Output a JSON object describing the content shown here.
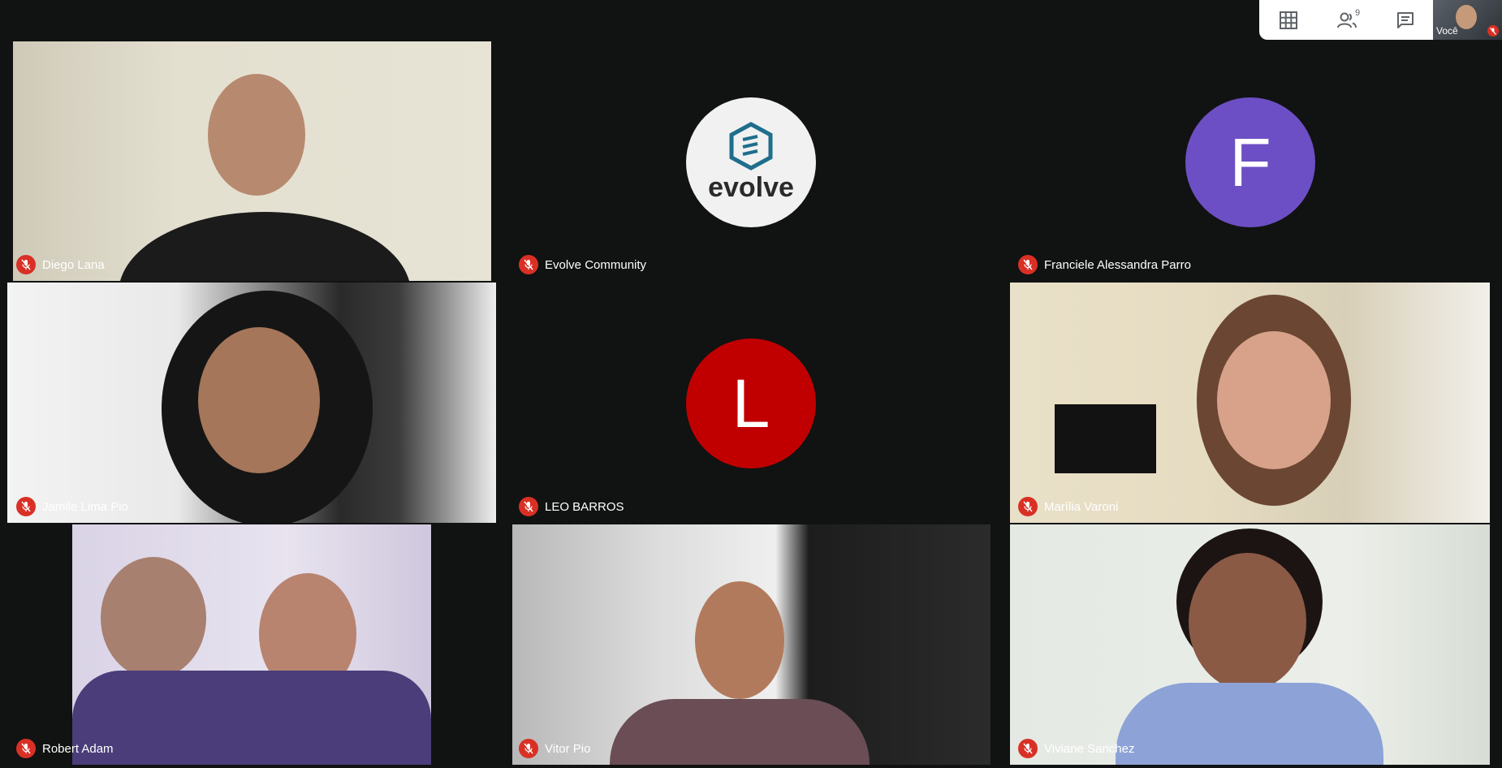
{
  "toolbar": {
    "icons": [
      "grid-view-icon",
      "people-icon",
      "chat-icon"
    ],
    "participant_count": "9"
  },
  "self_view": {
    "label": "Você"
  },
  "participants": [
    {
      "name": "Diego Lana"
    },
    {
      "name": "Evolve Community",
      "logo_text": "evolve"
    },
    {
      "name": "Franciele Alessandra Parro",
      "initial": "F",
      "color": "#6c4fc4"
    },
    {
      "name": "Jamile Lima Pio"
    },
    {
      "name": "LEO BARROS",
      "initial": "L",
      "color": "#c00000"
    },
    {
      "name": "Marília Varoni"
    },
    {
      "name": "Robert Adam"
    },
    {
      "name": "Vitor Pio"
    },
    {
      "name": "Viviane Sanchez"
    }
  ],
  "colors": {
    "background": "#111212",
    "muted_mic": "#d93025",
    "logo_teal": "#1f6e8c"
  }
}
